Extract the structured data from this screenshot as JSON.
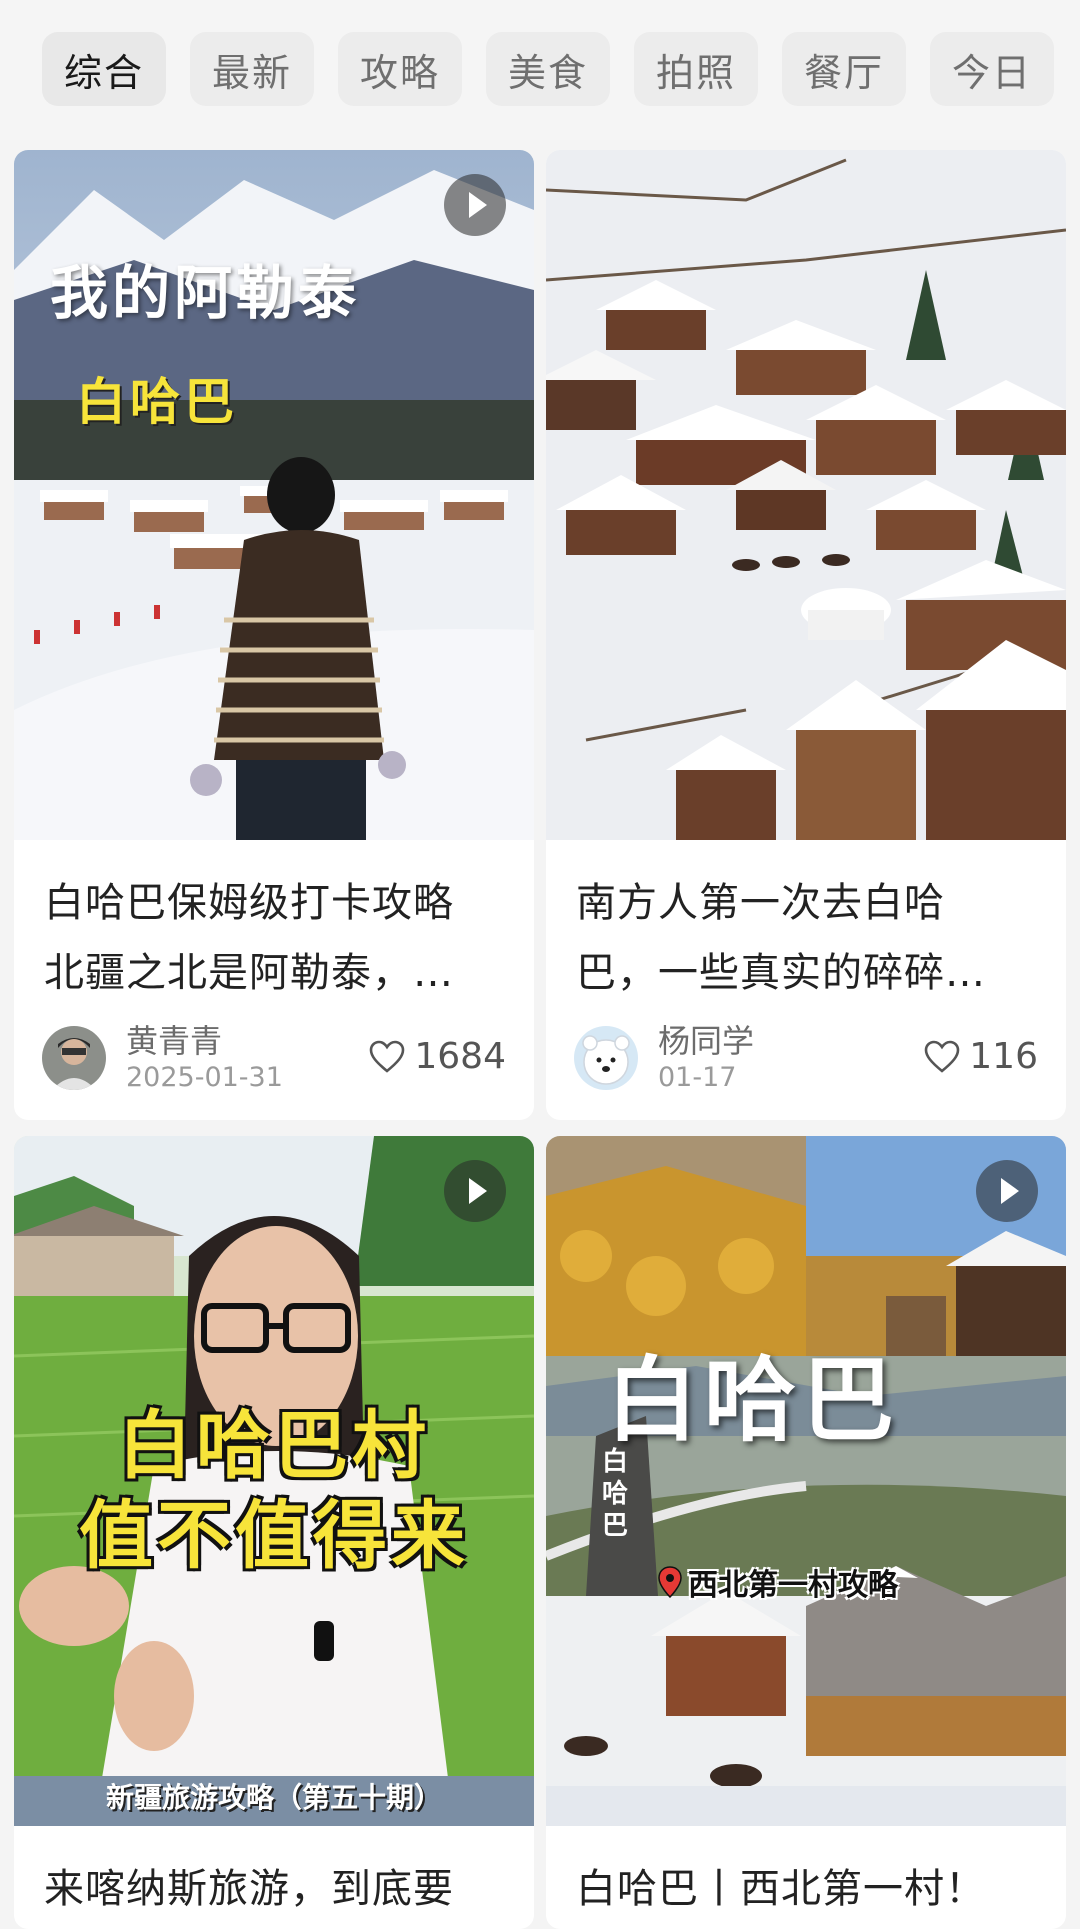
{
  "tabs": [
    "综合",
    "最新",
    "攻略",
    "美食",
    "拍照",
    "餐厅",
    "今日"
  ],
  "cards": [
    {
      "overlay_title": "我的阿勒泰",
      "overlay_sub": "白哈巴",
      "title_line1": "白哈巴保姆级打卡攻略",
      "title_line2": "北疆之北是阿勒泰，…",
      "author": "黄青青",
      "date": "2025-01-31",
      "likes": "1684"
    },
    {
      "title_line1": "南方人第一次去白哈",
      "title_line2": "巴，一些真实的碎碎…",
      "author": "杨同学",
      "date": "01-17",
      "likes": "116"
    },
    {
      "overlay_line1": "白哈巴村",
      "overlay_line2": "值不值得来",
      "overlay_caption": "新疆旅游攻略（第五十期）",
      "title_line1": "来喀纳斯旅游，到底要"
    },
    {
      "overlay_title": "白哈巴",
      "overlay_sign": "白哈巴",
      "overlay_tag": "西北第一村攻略",
      "title_line1": "白哈巴丨西北第一村！"
    }
  ],
  "icons": {
    "like": "heart-icon",
    "video": "play-icon",
    "pin": "location-pin-icon"
  },
  "colors": {
    "overlay_yellow": "#f7e43a",
    "like_gray": "#555555",
    "tag_bg": "#ececec"
  }
}
